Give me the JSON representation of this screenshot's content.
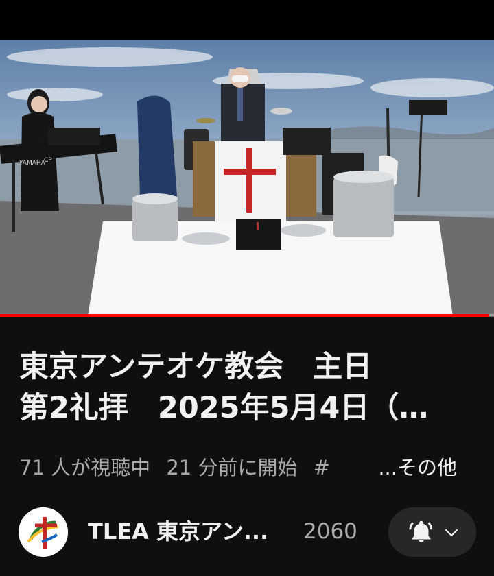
{
  "video": {
    "title_lines": [
      "東京アンテオケ教会　主日",
      "第2礼拝　2025年5月4日（…"
    ],
    "progress_fraction": 0.99,
    "scene": {
      "keyboard_brand": "YAMAHA",
      "keyboard_model": "CP"
    }
  },
  "meta": {
    "viewers": "71 人が視聴中",
    "started": "21 分前に開始",
    "hashtag": "#",
    "more": "...その他"
  },
  "channel": {
    "name": "TLEA 東京アン...",
    "subscribers": "2060",
    "avatar_icon": "church-cross-logo"
  },
  "subscribe_button": {
    "icon": "bell-icon",
    "dropdown_icon": "chevron-down-icon"
  },
  "colors": {
    "background": "#0f0f0f",
    "button_bg": "#272727",
    "progress": "#ff0000",
    "secondary_text": "#aaaaaa",
    "cross_red": "#c62828"
  }
}
